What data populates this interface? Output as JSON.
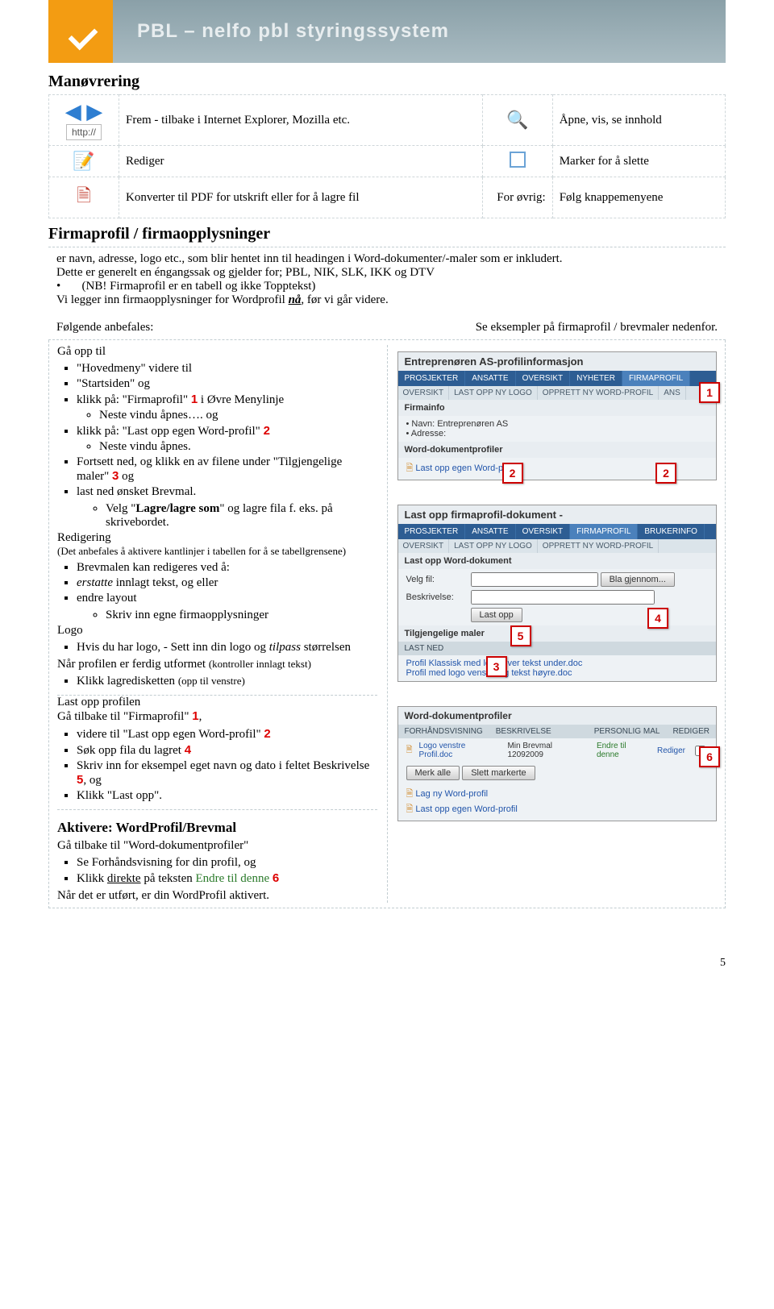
{
  "banner_text": "PBL – nelfo pbl styringssystem",
  "section_manovrering": "Manøvrering",
  "manov": {
    "r1c1": "Frem - tilbake i Internet Explorer, Mozilla etc.",
    "http": "http://",
    "r1c2": "Åpne, vis, se innhold",
    "r2c1": "Rediger",
    "r2c2": "Marker for å slette",
    "r3c1": "Konverter til PDF for utskrift eller for å lagre fil",
    "r3mid": "For øvrig:",
    "r3c2": "Følg knappemenyene"
  },
  "section_firma_heading": "Firmaprofil / firmaopplysninger",
  "firma_intro1": "er navn, adresse, logo etc., som blir hentet inn til headingen i Word-dokumenter/-maler som er inkludert.",
  "firma_intro2": "Dette er generelt en éngangssak og gjelder for; PBL, NIK, SLK, IKK og DTV",
  "firma_intro3_bullet": "(NB! Firmaprofil er en tabell og ikke Topptekst)",
  "firma_intro4_pre": "Vi legger inn firmaopplysninger for Wordprofil ",
  "firma_intro4_bold": "nå",
  "firma_intro4_post": ", før vi går videre.",
  "folgende_anbefales": "Følgende anbefales:",
  "se_eksempler": "Se eksempler på firmaprofil / brevmaler nedenfor.",
  "left": {
    "ga_opp_til": "Gå opp til",
    "items1": [
      "\"Hovedmeny\" videre til",
      "\"Startsiden\" og"
    ],
    "klikk_firmaprofil_pre": "klikk på: \"Firmaprofil\" ",
    "klikk_firmaprofil_post": " i Øvre Menylinje",
    "neste1": "Neste vindu åpnes…. og",
    "klikk_lastopp_pre": "klikk på: \"Last opp egen Word-profil\" ",
    "neste2": "Neste vindu åpnes.",
    "fortsett_pre": "Fortsett ned, og klikk en av filene under \"Tilgjengelige maler\" ",
    "fortsett_post": " og",
    "last_ned": "last ned ønsket Brevmal.",
    "velg_lagre_pre": "Velg \"",
    "velg_lagre_bold": "Lagre/lagre som",
    "velg_lagre_post": "\" og lagre fila f. eks. på skrivebordet.",
    "redigering_h": "Redigering",
    "redigering_note": "(Det anbefales å aktivere kantlinjer i tabellen for å se tabellgrensene)",
    "brevmal_intro": "Brevmalen  kan redigeres ved å:",
    "erstatte_pre": "erstatte",
    "erstatte_post": " innlagt tekst, og eller",
    "endre_layout": "endre layout",
    "skriv_inn": "Skriv inn egne firmaopplysninger",
    "logo_h": "Logo",
    "logo_text_pre": "Hvis du har logo, - Sett inn din logo og ",
    "logo_text_italic": "tilpass",
    "logo_text_post": " størrelsen",
    "nar_profil_pre": "Når profilen er ferdig utformet ",
    "nar_profil_small": "(kontroller innlagt tekst)",
    "klikk_lagre": "Klikk lagredisketten ",
    "klikk_lagre_small": "(opp til venstre)",
    "last_opp_profilen": "Last opp profilen",
    "ga_tilbake_firm_pre": "Gå tilbake til \"Firmaprofil\" ",
    "ga_tilbake_firm_post": ",",
    "videre_til_pre": "videre til \"Last opp egen Word-profil\" ",
    "sok_opp_pre": "Søk opp fila du lagret  ",
    "skriv_inn_eks_pre": "Skriv inn for eksempel eget navn og dato i feltet Beskrivelse  ",
    "skriv_inn_eks_post": ", og",
    "klikk_last_opp": "Klikk \"Last opp\".",
    "aktivere_h": "Aktivere: WordProfil/Brevmal",
    "aktivere_line1": "Gå tilbake til \"Word-dokumentprofiler\"",
    "aktivere_b1": "Se Forhåndsvisning for din profil, og",
    "aktivere_b2_pre": "Klikk ",
    "aktivere_b2_u": "direkte",
    "aktivere_b2_mid": " på teksten ",
    "aktivere_b2_green": "Endre til denne",
    "aktivere_last": "Når det er utført, er din WordProfil aktivert."
  },
  "ss1": {
    "title": "Entreprenøren AS-profilinformasjon",
    "tabs": [
      "PROSJEKTER",
      "ANSATTE",
      "OVERSIKT",
      "NYHETER",
      "FIRMAPROFIL"
    ],
    "subtabs": [
      "OVERSIKT",
      "LAST OPP NY LOGO",
      "OPPRETT NY WORD-PROFIL",
      "ANS"
    ],
    "firmainfo": "Firmainfo",
    "navn_lbl": "• Navn: Entreprenøren AS",
    "adresse_lbl": "• Adresse:",
    "wdp": "Word-dokumentprofiler",
    "lastopp": "Last opp egen Word-profil"
  },
  "ss2": {
    "title": "Last opp firmaprofil-dokument -",
    "tabs": [
      "PROSJEKTER",
      "ANSATTE",
      "OVERSIKT",
      "FIRMAPROFIL",
      "BRUKERINFO"
    ],
    "subtabs": [
      "OVERSIKT",
      "LAST OPP NY LOGO",
      "OPPRETT NY WORD-PROFIL"
    ],
    "upload_h": "Last opp Word-dokument",
    "velg_fil": "Velg fil:",
    "bla": "Bla gjennom...",
    "beskrivelse": "Beskrivelse:",
    "lastopp_btn": "Last opp",
    "tilgj": "Tilgjengelige maler",
    "lastned": "LAST NED",
    "file1": "Profil Klassisk med logo over tekst under.doc",
    "file2": "Profil med logo venstre og tekst høyre.doc"
  },
  "ss3": {
    "title": "Word-dokumentprofiler",
    "cols": [
      "FORHÅNDSVISNING",
      "BESKRIVELSE",
      "PERSONLIG MAL",
      "REDIGER"
    ],
    "row": {
      "fn": "Logo venstre Profil.doc",
      "besk": "Min Brevmal 12092009",
      "endre": "Endre til denne",
      "rediger": "Rediger"
    },
    "btn_merk": "Merk alle",
    "btn_slett": "Slett markerte",
    "lag_ny": "Lag ny Word-profil",
    "lastopp": "Last opp egen Word-profil"
  },
  "markers": {
    "m1": "1",
    "m2": "2",
    "m2b": "2",
    "m3": "3",
    "m4": "4",
    "m5": "5",
    "m6": "6"
  },
  "page_number": "5"
}
